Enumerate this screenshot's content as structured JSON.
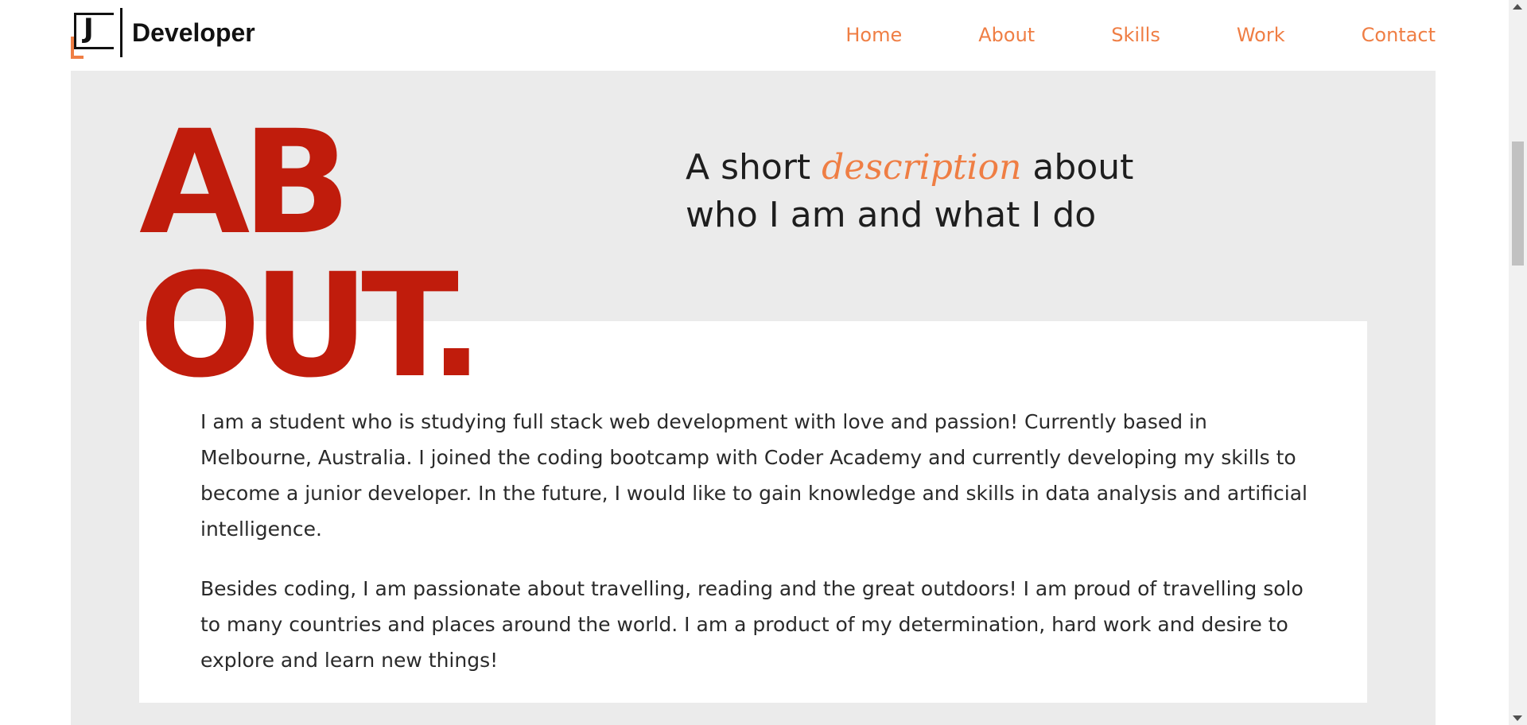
{
  "header": {
    "logo": {
      "mark_letter": "J",
      "text": "Developer"
    },
    "nav": [
      {
        "label": "Home"
      },
      {
        "label": "About"
      },
      {
        "label": "Skills"
      },
      {
        "label": "Work"
      },
      {
        "label": "Contact"
      }
    ]
  },
  "about": {
    "title_line1": "AB",
    "title_line2": "OUT.",
    "subtitle_before": "A short ",
    "subtitle_accent": "description",
    "subtitle_after_line1": " about",
    "subtitle_line2": "who I am and what I do",
    "paragraphs": [
      "I am a student who is studying full stack web development with love and passion! Currently based in Melbourne, Australia. I joined the coding bootcamp with Coder Academy and currently developing my skills to become a junior developer. In the future, I would like to gain knowledge and skills in data analysis and artificial intelligence.",
      "Besides coding, I am passionate about travelling, reading and the great outdoors! I am proud of travelling solo to many countries and places around the world. I am a product of my determination, hard work and desire to explore and learn new things!"
    ]
  },
  "colors": {
    "accent": "#ef7e44",
    "title_red": "#c01c0c",
    "section_bg": "#ebebeb",
    "card_bg": "#ffffff",
    "text": "#1e1e1e"
  },
  "icons": {
    "logo": "logo-icon",
    "scroll_up": "scroll-up-arrow-icon",
    "scroll_down": "scroll-down-arrow-icon"
  }
}
